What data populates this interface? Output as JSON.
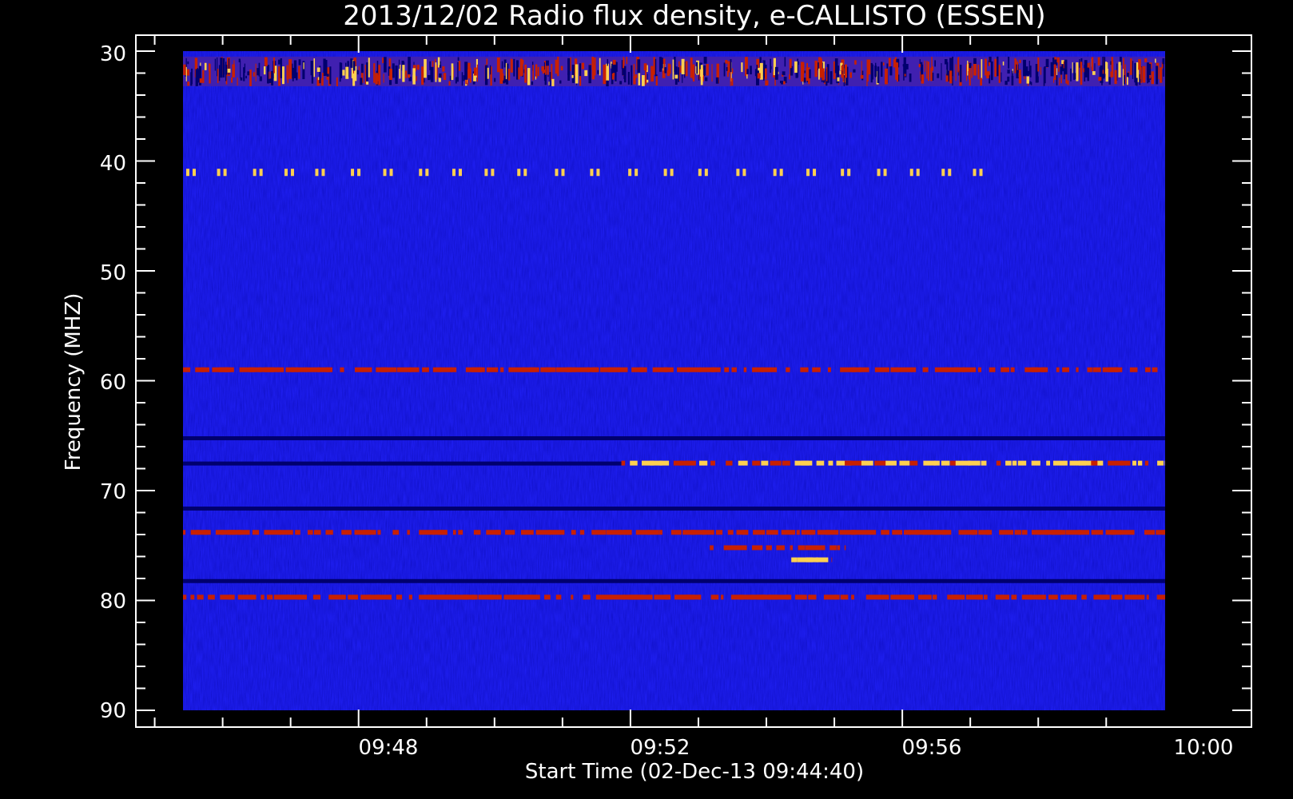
{
  "chart_data": {
    "type": "heatmap",
    "title": "2013/12/02  Radio flux density, e-CALLISTO (ESSEN)",
    "xlabel": "Start Time (02-Dec-13 09:44:40)",
    "ylabel": "Frequency (MHZ)",
    "x_ticks": [
      "09:48",
      "09:52",
      "09:56",
      "10:00"
    ],
    "y_ticks": [
      "30",
      "40",
      "50",
      "60",
      "70",
      "80",
      "90"
    ],
    "ylim": [
      30,
      90
    ],
    "xlim_minutes_after_start": [
      0,
      15.33
    ],
    "data_extent": {
      "time_start_minutes_after_start": 0.75,
      "time_end_minutes_after_start": 15.2,
      "freq_top_mhz": 30,
      "freq_bottom_mhz": 90
    },
    "y_axis_inverted": true,
    "grid": false,
    "colors": {
      "background": "#000000",
      "axes": "#ffffff",
      "low": "#1e1ef0",
      "dark": "#00006e",
      "mid": "#c82000",
      "high": "#ffd050"
    },
    "features": [
      {
        "kind": "noise-band",
        "freq_mhz_range": [
          30.5,
          33.2
        ],
        "t_minutes_after_start": [
          0.75,
          15.2
        ],
        "level": "mixed"
      },
      {
        "kind": "interference-dashes",
        "freq_mhz": 41,
        "t_minutes_after_start": [
          0.75,
          12.9
        ],
        "level": "high"
      },
      {
        "kind": "line",
        "freq_mhz": 59,
        "t_minutes_after_start": [
          0.75,
          15.2
        ],
        "level": "mid"
      },
      {
        "kind": "line",
        "freq_mhz": 65.2,
        "t_minutes_after_start": [
          0.75,
          15.2
        ],
        "level": "dark"
      },
      {
        "kind": "line",
        "freq_mhz": 67.5,
        "t_minutes_after_start": [
          0.75,
          7.2
        ],
        "level": "dark"
      },
      {
        "kind": "line",
        "freq_mhz": 67.5,
        "t_minutes_after_start": [
          7.2,
          15.2
        ],
        "level": "high"
      },
      {
        "kind": "line",
        "freq_mhz": 71.6,
        "t_minutes_after_start": [
          0.75,
          15.2
        ],
        "level": "dark"
      },
      {
        "kind": "line",
        "freq_mhz": 73.8,
        "t_minutes_after_start": [
          0.75,
          15.2
        ],
        "level": "mid"
      },
      {
        "kind": "line",
        "freq_mhz": 75.2,
        "t_minutes_after_start": [
          8.5,
          10.5
        ],
        "level": "mid"
      },
      {
        "kind": "line",
        "freq_mhz": 76.3,
        "t_minutes_after_start": [
          9.7,
          10.3
        ],
        "level": "high"
      },
      {
        "kind": "line",
        "freq_mhz": 78.2,
        "t_minutes_after_start": [
          0.75,
          15.2
        ],
        "level": "dark"
      },
      {
        "kind": "line",
        "freq_mhz": 79.7,
        "t_minutes_after_start": [
          0.75,
          15.2
        ],
        "level": "mid"
      }
    ]
  }
}
